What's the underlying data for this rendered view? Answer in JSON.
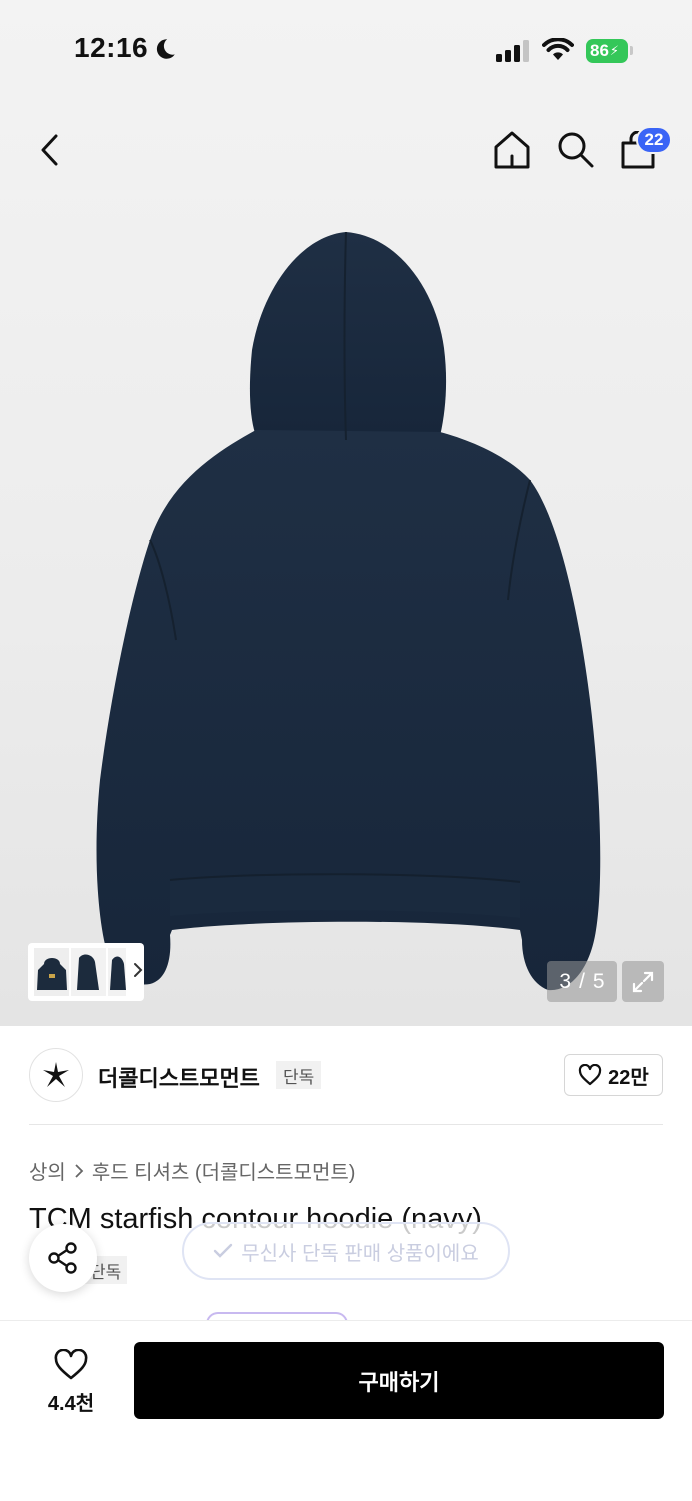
{
  "status_bar": {
    "time": "12:16",
    "battery": "86"
  },
  "header": {
    "cart_count": "22"
  },
  "gallery": {
    "current": "3",
    "total": "5",
    "counter_sep": "/"
  },
  "brand": {
    "name": "더콜디스트모먼트",
    "exclusive_tag": "단독",
    "likes": "22만"
  },
  "breadcrumb": {
    "category": "상의",
    "subcategory": "후드 티셔츠 (더콜디스트모먼트)"
  },
  "product": {
    "title": "TCM starfish contour hoodie (navy)",
    "exclusive_tag": "단독"
  },
  "toast": {
    "message": "무신사 단독 판매 상품이에요"
  },
  "bottom_bar": {
    "wish_count": "4.4천",
    "buy_label": "구매하기"
  },
  "colors": {
    "accent_blue": "#3a64f6",
    "hoodie_navy": "#1c2b3d",
    "battery_green": "#34c759",
    "buy_button": "#000000"
  }
}
